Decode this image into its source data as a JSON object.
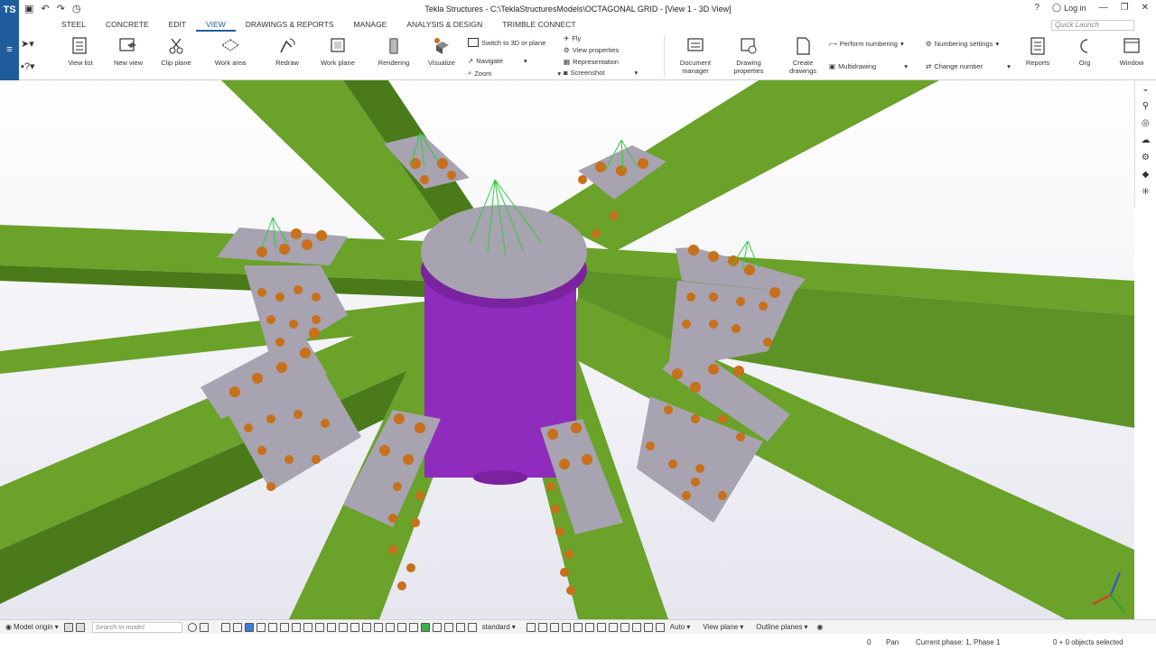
{
  "window": {
    "title": "Tekla Structures - C:\\TeklaStructuresModels\\OCTAGONAL GRID - [View 1 - 3D View]",
    "login": "Log in"
  },
  "tabs": [
    "STEEL",
    "CONCRETE",
    "EDIT",
    "VIEW",
    "DRAWINGS & REPORTS",
    "MANAGE",
    "ANALYSIS & DESIGN",
    "TRIMBLE CONNECT"
  ],
  "active_tab": "VIEW",
  "quick_launch_placeholder": "Quick Launch",
  "ribbon": {
    "view_list": "View list",
    "new_view": "New view",
    "clip_plane": "Clip plane",
    "work_area": "Work area",
    "redraw": "Redraw",
    "work_plane": "Work plane",
    "rendering": "Rendering",
    "visualize": "Visualize",
    "switch_3d": "Switch to 3D or plane",
    "navigate": "Navigate",
    "zoom": "Zoom",
    "fly": "Fly",
    "view_properties": "View properties",
    "representation": "Representation",
    "screenshot": "Screenshot",
    "document_manager_1": "Document",
    "document_manager_2": "manager",
    "drawing_properties_1": "Drawing",
    "drawing_properties_2": "properties",
    "create_drawings_1": "Create",
    "create_drawings_2": "drawings",
    "perform_numbering": "Perform numbering",
    "multidrawing": "Multidrawing",
    "numbering_settings": "Numbering settings",
    "change_number": "Change number",
    "reports": "Reports",
    "org": "Org",
    "window": "Window"
  },
  "bottom_toolbar": {
    "model_origin": "Model origin",
    "search_placeholder": "Search in model",
    "filter": "standard",
    "auto": "Auto",
    "view_plane": "View plane",
    "outline_planes": "Outline planes"
  },
  "status": {
    "count": "0",
    "mode": "Pan",
    "phase": "Current phase: 1, Phase 1",
    "selection": "0 + 0 objects selected"
  },
  "colors": {
    "beam_green": "#6aa22a",
    "beam_dark": "#4a7a1a",
    "plate_grey": "#a7a3b0",
    "column_purple": "#8f2bbd",
    "bolt_orange": "#c8701a",
    "brand_blue": "#1f5c9c"
  }
}
